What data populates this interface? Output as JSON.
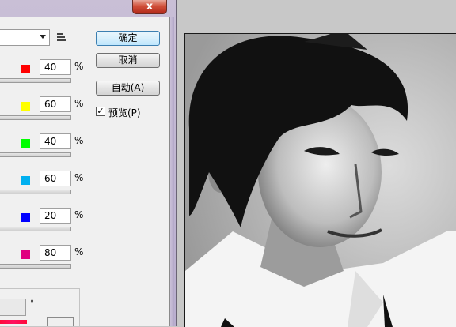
{
  "dialog": {
    "close_label": "x",
    "buttons": {
      "ok": "确定",
      "cancel": "取消",
      "auto": "自动(A)"
    },
    "preview": {
      "label": "预览(P)",
      "checked": true
    }
  },
  "channels": [
    {
      "color_name": "red",
      "color": "#ff0000",
      "value": "40",
      "unit": "%"
    },
    {
      "color_name": "yellow",
      "color": "#ffff00",
      "value": "60",
      "unit": "%"
    },
    {
      "color_name": "green",
      "color": "#00ff00",
      "value": "40",
      "unit": "%"
    },
    {
      "color_name": "cyan",
      "color": "#00b0f0",
      "value": "60",
      "unit": "%"
    },
    {
      "color_name": "blue",
      "color": "#0000ff",
      "value": "20",
      "unit": "%"
    },
    {
      "color_name": "magenta",
      "color": "#e0007f",
      "value": "80",
      "unit": "%"
    }
  ],
  "tint": {
    "degree_symbol": "°",
    "hue_color": "#ff0a3a"
  },
  "photo": {
    "description_icon": "portrait-photo"
  }
}
